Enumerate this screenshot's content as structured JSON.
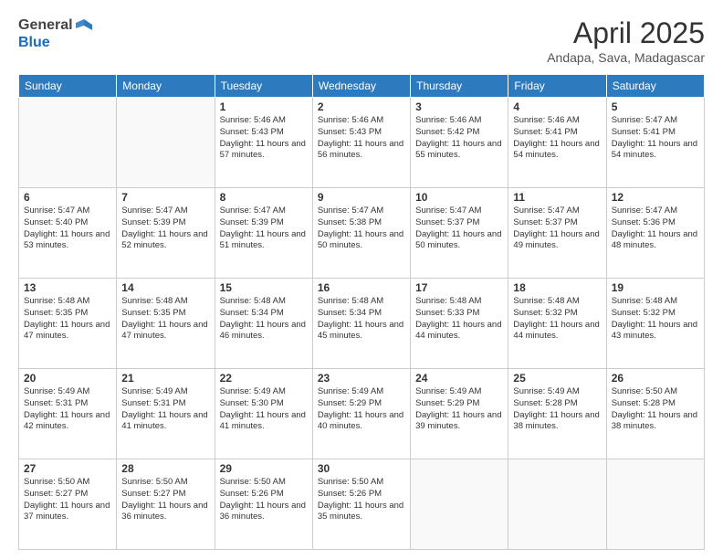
{
  "header": {
    "logo_line1": "General",
    "logo_line2": "Blue",
    "month_year": "April 2025",
    "location": "Andapa, Sava, Madagascar"
  },
  "weekdays": [
    "Sunday",
    "Monday",
    "Tuesday",
    "Wednesday",
    "Thursday",
    "Friday",
    "Saturday"
  ],
  "weeks": [
    [
      {
        "day": "",
        "info": ""
      },
      {
        "day": "",
        "info": ""
      },
      {
        "day": "1",
        "info": "Sunrise: 5:46 AM\nSunset: 5:43 PM\nDaylight: 11 hours and 57 minutes."
      },
      {
        "day": "2",
        "info": "Sunrise: 5:46 AM\nSunset: 5:43 PM\nDaylight: 11 hours and 56 minutes."
      },
      {
        "day": "3",
        "info": "Sunrise: 5:46 AM\nSunset: 5:42 PM\nDaylight: 11 hours and 55 minutes."
      },
      {
        "day": "4",
        "info": "Sunrise: 5:46 AM\nSunset: 5:41 PM\nDaylight: 11 hours and 54 minutes."
      },
      {
        "day": "5",
        "info": "Sunrise: 5:47 AM\nSunset: 5:41 PM\nDaylight: 11 hours and 54 minutes."
      }
    ],
    [
      {
        "day": "6",
        "info": "Sunrise: 5:47 AM\nSunset: 5:40 PM\nDaylight: 11 hours and 53 minutes."
      },
      {
        "day": "7",
        "info": "Sunrise: 5:47 AM\nSunset: 5:39 PM\nDaylight: 11 hours and 52 minutes."
      },
      {
        "day": "8",
        "info": "Sunrise: 5:47 AM\nSunset: 5:39 PM\nDaylight: 11 hours and 51 minutes."
      },
      {
        "day": "9",
        "info": "Sunrise: 5:47 AM\nSunset: 5:38 PM\nDaylight: 11 hours and 50 minutes."
      },
      {
        "day": "10",
        "info": "Sunrise: 5:47 AM\nSunset: 5:37 PM\nDaylight: 11 hours and 50 minutes."
      },
      {
        "day": "11",
        "info": "Sunrise: 5:47 AM\nSunset: 5:37 PM\nDaylight: 11 hours and 49 minutes."
      },
      {
        "day": "12",
        "info": "Sunrise: 5:47 AM\nSunset: 5:36 PM\nDaylight: 11 hours and 48 minutes."
      }
    ],
    [
      {
        "day": "13",
        "info": "Sunrise: 5:48 AM\nSunset: 5:35 PM\nDaylight: 11 hours and 47 minutes."
      },
      {
        "day": "14",
        "info": "Sunrise: 5:48 AM\nSunset: 5:35 PM\nDaylight: 11 hours and 47 minutes."
      },
      {
        "day": "15",
        "info": "Sunrise: 5:48 AM\nSunset: 5:34 PM\nDaylight: 11 hours and 46 minutes."
      },
      {
        "day": "16",
        "info": "Sunrise: 5:48 AM\nSunset: 5:34 PM\nDaylight: 11 hours and 45 minutes."
      },
      {
        "day": "17",
        "info": "Sunrise: 5:48 AM\nSunset: 5:33 PM\nDaylight: 11 hours and 44 minutes."
      },
      {
        "day": "18",
        "info": "Sunrise: 5:48 AM\nSunset: 5:32 PM\nDaylight: 11 hours and 44 minutes."
      },
      {
        "day": "19",
        "info": "Sunrise: 5:48 AM\nSunset: 5:32 PM\nDaylight: 11 hours and 43 minutes."
      }
    ],
    [
      {
        "day": "20",
        "info": "Sunrise: 5:49 AM\nSunset: 5:31 PM\nDaylight: 11 hours and 42 minutes."
      },
      {
        "day": "21",
        "info": "Sunrise: 5:49 AM\nSunset: 5:31 PM\nDaylight: 11 hours and 41 minutes."
      },
      {
        "day": "22",
        "info": "Sunrise: 5:49 AM\nSunset: 5:30 PM\nDaylight: 11 hours and 41 minutes."
      },
      {
        "day": "23",
        "info": "Sunrise: 5:49 AM\nSunset: 5:29 PM\nDaylight: 11 hours and 40 minutes."
      },
      {
        "day": "24",
        "info": "Sunrise: 5:49 AM\nSunset: 5:29 PM\nDaylight: 11 hours and 39 minutes."
      },
      {
        "day": "25",
        "info": "Sunrise: 5:49 AM\nSunset: 5:28 PM\nDaylight: 11 hours and 38 minutes."
      },
      {
        "day": "26",
        "info": "Sunrise: 5:50 AM\nSunset: 5:28 PM\nDaylight: 11 hours and 38 minutes."
      }
    ],
    [
      {
        "day": "27",
        "info": "Sunrise: 5:50 AM\nSunset: 5:27 PM\nDaylight: 11 hours and 37 minutes."
      },
      {
        "day": "28",
        "info": "Sunrise: 5:50 AM\nSunset: 5:27 PM\nDaylight: 11 hours and 36 minutes."
      },
      {
        "day": "29",
        "info": "Sunrise: 5:50 AM\nSunset: 5:26 PM\nDaylight: 11 hours and 36 minutes."
      },
      {
        "day": "30",
        "info": "Sunrise: 5:50 AM\nSunset: 5:26 PM\nDaylight: 11 hours and 35 minutes."
      },
      {
        "day": "",
        "info": ""
      },
      {
        "day": "",
        "info": ""
      },
      {
        "day": "",
        "info": ""
      }
    ]
  ]
}
